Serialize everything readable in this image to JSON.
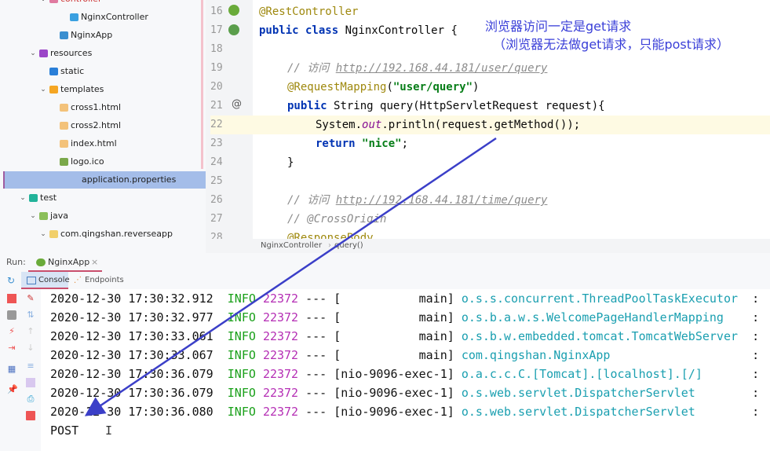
{
  "project_tree": {
    "items": [
      {
        "label": "controller",
        "type": "folder",
        "indent": 4,
        "expanded": true,
        "partial": true
      },
      {
        "label": "NginxController",
        "type": "class",
        "indent": 6
      },
      {
        "label": "NginxApp",
        "type": "springapp",
        "indent": 5
      },
      {
        "label": "resources",
        "type": "resources-folder",
        "indent": 3,
        "expanded": true
      },
      {
        "label": "static",
        "type": "folder-blue",
        "indent": 4
      },
      {
        "label": "templates",
        "type": "folder-orange",
        "indent": 4,
        "expanded": true
      },
      {
        "label": "cross1.html",
        "type": "html",
        "indent": 5
      },
      {
        "label": "cross2.html",
        "type": "html",
        "indent": 5
      },
      {
        "label": "index.html",
        "type": "html",
        "indent": 5
      },
      {
        "label": "logo.ico",
        "type": "image",
        "indent": 5
      },
      {
        "label": "application.properties",
        "type": "properties",
        "indent": 5,
        "selected": true
      },
      {
        "label": "test",
        "type": "test-folder",
        "indent": 2,
        "expanded": true
      },
      {
        "label": "java",
        "type": "folder-green",
        "indent": 3,
        "expanded": true
      },
      {
        "label": "com.qingshan.reverseapp",
        "type": "package",
        "indent": 4,
        "expanded": true
      }
    ]
  },
  "editor": {
    "line_numbers": [
      "16",
      "17",
      "18",
      "19",
      "20",
      "21",
      "22",
      "23",
      "24",
      "25",
      "26",
      "27",
      "28"
    ],
    "current_line": "22",
    "lines": {
      "l16": "@RestController",
      "l17_kw": "public class ",
      "l17_rest": "NginxController {",
      "l19_c": "// 访问 ",
      "l19_url": "http://192.168.44.181/user/query",
      "l20_ann": "@RequestMapping",
      "l20_p1": "(",
      "l20_str": "\"user/query\"",
      "l20_p2": ")",
      "l21_kw": "public ",
      "l21_rest": "String query(HttpServletRequest request){",
      "l22_a": "System.",
      "l22_fld": "out",
      "l22_b": ".println(request.getMethod());",
      "l23_kw": "return ",
      "l23_str": "\"nice\"",
      "l23_end": ";",
      "l24": "}",
      "l26_c": "// 访问 ",
      "l26_url": "http://192.168.44.181/time/query",
      "l27": "// @CrossOrigin",
      "l28": "@ResponseBody"
    },
    "breadcrumb": [
      "NginxController",
      "query()"
    ]
  },
  "annotation": {
    "line1": "浏览器访问一定是get请求",
    "line2": "  （浏览器无法做get请求，只能post请求）",
    "color": "#3a3fd8"
  },
  "run_panel": {
    "run_label": "Run:",
    "app_tab": "NginxApp",
    "tabs": [
      "Console",
      "Endpoints"
    ],
    "active_tab": "Console",
    "log": [
      {
        "ts": "2020-12-30 17:30:32.912",
        "level": "INFO",
        "pid": "22372",
        "sep": "---",
        "thread": "[           main]",
        "logger": "o.s.s.concurrent.ThreadPoolTaskExecutor ",
        "colon": ":"
      },
      {
        "ts": "2020-12-30 17:30:32.977",
        "level": "INFO",
        "pid": "22372",
        "sep": "---",
        "thread": "[           main]",
        "logger": "o.s.b.a.w.s.WelcomePageHandlerMapping   ",
        "colon": ":"
      },
      {
        "ts": "2020-12-30 17:30:33.061",
        "level": "INFO",
        "pid": "22372",
        "sep": "---",
        "thread": "[           main]",
        "logger": "o.s.b.w.embedded.tomcat.TomcatWebServer ",
        "colon": ":"
      },
      {
        "ts": "2020-12-30 17:30:33.067",
        "level": "INFO",
        "pid": "22372",
        "sep": "---",
        "thread": "[           main]",
        "logger": "com.qingshan.NginxApp                   ",
        "colon": ":"
      },
      {
        "ts": "2020-12-30 17:30:36.079",
        "level": "INFO",
        "pid": "22372",
        "sep": "---",
        "thread": "[nio-9096-exec-1]",
        "logger": "o.a.c.c.C.[Tomcat].[localhost].[/]      ",
        "colon": ":"
      },
      {
        "ts": "2020-12-30 17:30:36.079",
        "level": "INFO",
        "pid": "22372",
        "sep": "---",
        "thread": "[nio-9096-exec-1]",
        "logger": "o.s.web.servlet.DispatcherServlet       ",
        "colon": ":"
      },
      {
        "ts": "2020-12-30 17:30:36.080",
        "level": "INFO",
        "pid": "22372",
        "sep": "---",
        "thread": "[nio-9096-exec-1]",
        "logger": "o.s.web.servlet.DispatcherServlet       ",
        "colon": ":"
      }
    ],
    "output": "POST"
  }
}
